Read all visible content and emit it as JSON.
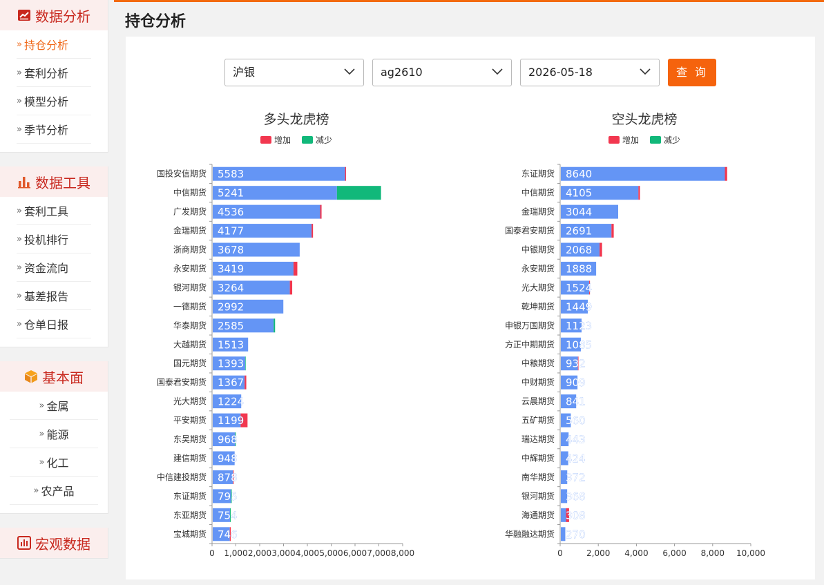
{
  "sidebar": {
    "data_analysis": {
      "title": "数据分析",
      "items": [
        "持仓分析",
        "套利分析",
        "模型分析",
        "季节分析"
      ]
    },
    "data_tools": {
      "title": "数据工具",
      "items": [
        "套利工具",
        "投机排行",
        "资金流向",
        "基差报告",
        "仓单日报"
      ]
    },
    "fundamentals": {
      "title": "基本面",
      "items": [
        "金属",
        "能源",
        "化工",
        "农产品"
      ]
    },
    "macro": {
      "title": "宏观数据"
    },
    "arrow": "»"
  },
  "page": {
    "title": "持仓分析"
  },
  "filters": {
    "product": "沪银",
    "contract": "ag2610",
    "date": "2026-05-18",
    "query_label": "查 询"
  },
  "colors": {
    "base": "#6495f5",
    "increase": "#f2374f",
    "decrease": "#11b87a",
    "accent": "#f5630d"
  },
  "chart_data": [
    {
      "type": "bar",
      "orientation": "horizontal",
      "title": "多头龙虎榜",
      "legend": {
        "increase": "增加",
        "decrease": "减少",
        "position": "top-center"
      },
      "categories": [
        "国投安信期货",
        "中信期货",
        "广发期货",
        "金瑞期货",
        "浙商期货",
        "永安期货",
        "银河期货",
        "一德期货",
        "华泰期货",
        "大越期货",
        "国元期货",
        "国泰君安期货",
        "光大期货",
        "平安期货",
        "东吴期货",
        "建信期货",
        "中信建投期货",
        "东证期货",
        "东亚期货",
        "宝城期货"
      ],
      "values": [
        5583,
        5241,
        4536,
        4177,
        3678,
        3419,
        3264,
        2992,
        2585,
        1513,
        1393,
        1367,
        1224,
        1199,
        968,
        948,
        878,
        795,
        754,
        746
      ],
      "increase": [
        40,
        0,
        60,
        60,
        0,
        160,
        100,
        0,
        0,
        0,
        0,
        70,
        0,
        290,
        0,
        0,
        30,
        0,
        0,
        40
      ],
      "decrease": [
        0,
        1850,
        0,
        0,
        0,
        0,
        0,
        0,
        60,
        0,
        20,
        0,
        0,
        0,
        30,
        0,
        0,
        30,
        30,
        0
      ],
      "xlim": [
        0,
        8000
      ],
      "xticks": [
        "0",
        "1,000",
        "2,000",
        "3,000",
        "4,000",
        "5,000",
        "6,000",
        "7,000",
        "8,000"
      ]
    },
    {
      "type": "bar",
      "orientation": "horizontal",
      "title": "空头龙虎榜",
      "legend": {
        "increase": "增加",
        "decrease": "减少",
        "position": "top-center"
      },
      "categories": [
        "东证期货",
        "中信期货",
        "金瑞期货",
        "国泰君安期货",
        "中银期货",
        "永安期货",
        "光大期货",
        "乾坤期货",
        "申银万国期货",
        "方正中期期货",
        "中粮期货",
        "中财期货",
        "云晨期货",
        "五矿期货",
        "瑞达期货",
        "中辉期货",
        "南华期货",
        "银河期货",
        "海通期货",
        "华融融达期货"
      ],
      "values": [
        8640,
        4105,
        3044,
        2691,
        2068,
        1888,
        1524,
        1449,
        1123,
        1085,
        932,
        909,
        841,
        560,
        443,
        424,
        372,
        368,
        308,
        270
      ],
      "increase": [
        120,
        80,
        0,
        120,
        130,
        0,
        40,
        0,
        0,
        0,
        30,
        0,
        0,
        0,
        0,
        0,
        0,
        0,
        160,
        0
      ],
      "decrease": [
        0,
        0,
        0,
        0,
        0,
        0,
        0,
        0,
        0,
        0,
        0,
        0,
        0,
        0,
        0,
        0,
        0,
        0,
        0,
        0
      ],
      "xlim": [
        0,
        10000
      ],
      "xticks": [
        "0",
        "2,000",
        "4,000",
        "6,000",
        "8,000",
        "10,000"
      ]
    }
  ]
}
